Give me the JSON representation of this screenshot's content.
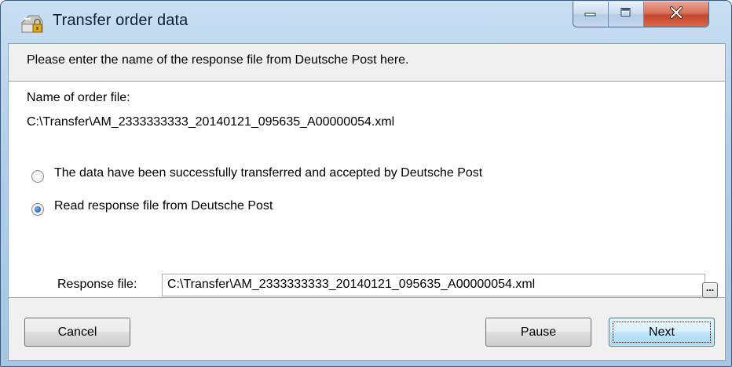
{
  "window": {
    "title": "Transfer order data",
    "app_icon": "package-lock-icon",
    "controls": {
      "minimize_icon": "minimize-icon",
      "maximize_icon": "maximize-icon",
      "close_icon": "close-icon"
    }
  },
  "header": {
    "instruction": "Please enter the name of the response file from Deutsche Post here."
  },
  "content": {
    "order_file_label": "Name of order file:",
    "order_file_path": "C:\\Transfer\\AM_2333333333_20140121_095635_A00000054.xml",
    "options": [
      {
        "label": "The data have been successfully transferred and accepted by Deutsche Post",
        "selected": false
      },
      {
        "label": "Read response file from Deutsche Post",
        "selected": true
      }
    ],
    "response_file_label": "Response file:",
    "response_file_value": "C:\\Transfer\\AM_2333333333_20140121_095635_A00000054.xml",
    "browse_label": "..."
  },
  "footer": {
    "cancel_label": "Cancel",
    "pause_label": "Pause",
    "next_label": "Next"
  },
  "colors": {
    "titlebar": "#b3cfea",
    "close_button": "#c4452a",
    "default_button_border": "#3c7fb1",
    "radio_selected": "#2a6fc7"
  }
}
